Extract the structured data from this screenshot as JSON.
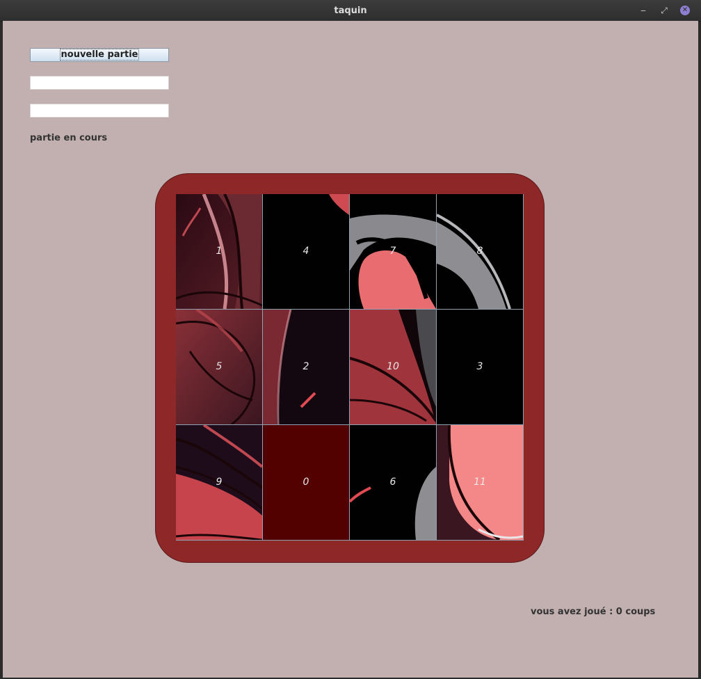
{
  "window": {
    "title": "taquin"
  },
  "controls": {
    "new_game_label": "nouvelle partie",
    "field1_value": "",
    "field2_value": "",
    "status_text": "partie en cours"
  },
  "board": {
    "rows": 3,
    "cols": 4,
    "tiles": [
      "1",
      "4",
      "7",
      "8",
      "5",
      "2",
      "10",
      "3",
      "9",
      "0",
      "6",
      "11"
    ],
    "empty_tile": "0"
  },
  "moves_text": "vous avez joué : 0 coups",
  "colors": {
    "background": "#c2b0b1",
    "frame": "#8e2828",
    "empty_tile": "#520000",
    "grid_lines": "#8fa3b3"
  }
}
